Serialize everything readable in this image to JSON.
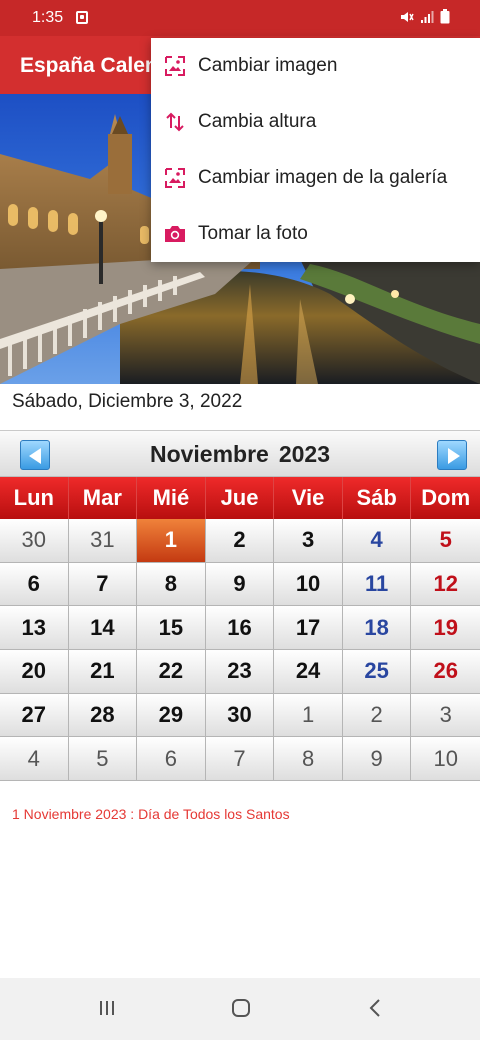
{
  "status_bar": {
    "time": "1:35"
  },
  "app_bar": {
    "title": "España Calendario"
  },
  "today": {
    "label": "Sábado, Diciembre 3, 2022"
  },
  "calendar": {
    "month": "Noviembre",
    "year": "2023",
    "weekdays": [
      "Lun",
      "Mar",
      "Mié",
      "Jue",
      "Vie",
      "Sáb",
      "Dom"
    ],
    "selected_day": "1",
    "weeks": [
      [
        "30",
        "31",
        "1",
        "2",
        "3",
        "4",
        "5"
      ],
      [
        "6",
        "7",
        "8",
        "9",
        "10",
        "11",
        "12"
      ],
      [
        "13",
        "14",
        "15",
        "16",
        "17",
        "18",
        "19"
      ],
      [
        "20",
        "21",
        "22",
        "23",
        "24",
        "25",
        "26"
      ],
      [
        "27",
        "28",
        "29",
        "30",
        "1",
        "2",
        "3"
      ],
      [
        "4",
        "5",
        "6",
        "7",
        "8",
        "9",
        "10"
      ]
    ]
  },
  "holiday_note": "1 Noviembre 2023 : Día de Todos los Santos",
  "menu": {
    "items": [
      {
        "label": "Cambiar imagen",
        "icon": "image-icon"
      },
      {
        "label": "Cambia altura",
        "icon": "swap-vertical-icon"
      },
      {
        "label": "Cambiar imagen de la galería",
        "icon": "gallery-icon"
      },
      {
        "label": "Tomar la foto",
        "icon": "camera-icon"
      }
    ]
  },
  "colors": {
    "primary": "#d32f2f",
    "status_bar": "#c62828",
    "accent_icon": "#d81b60",
    "selected_day": "#e0632a",
    "saturday": "#2946a0",
    "sunday": "#c0101a",
    "holiday_text": "#e53935"
  }
}
